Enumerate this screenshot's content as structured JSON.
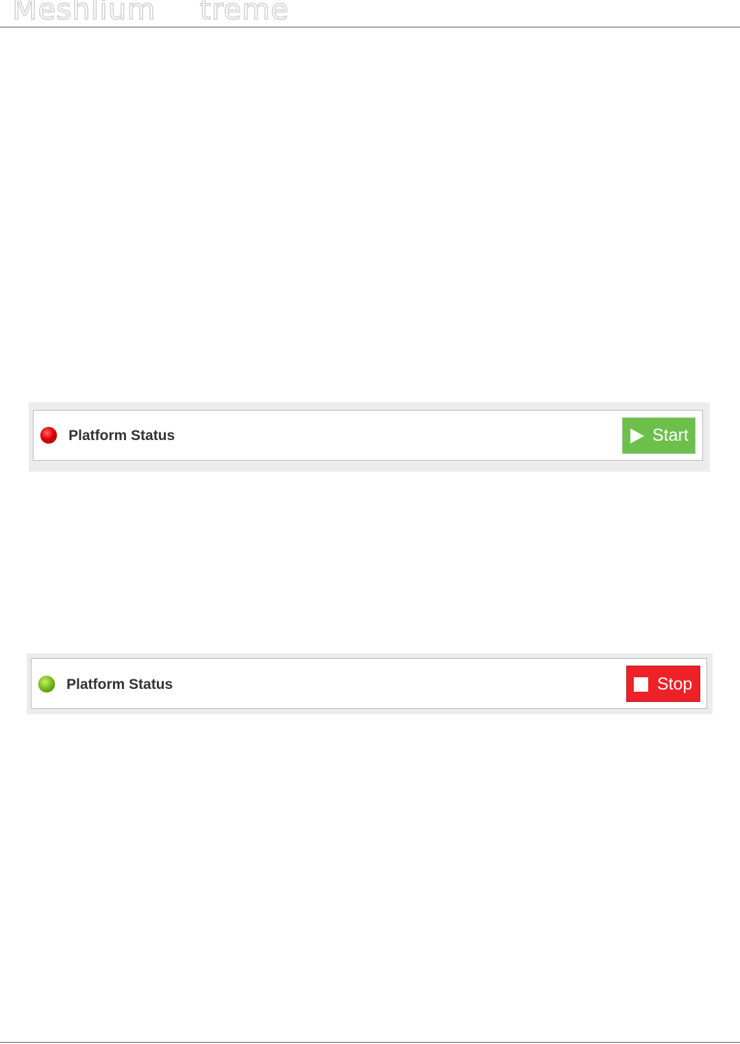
{
  "header": {
    "title_part1": "Meshlium",
    "title_part2": "treme"
  },
  "panels": [
    {
      "status": "stopped",
      "status_color": "#e00000",
      "label": "Platform Status",
      "button": {
        "label": "Start",
        "icon": "play-icon",
        "color": "#6cc04a"
      }
    },
    {
      "status": "running",
      "status_color": "#7cbf1e",
      "label": "Platform Status",
      "button": {
        "label": "Stop",
        "icon": "stop-icon",
        "color": "#ee2129"
      }
    }
  ]
}
